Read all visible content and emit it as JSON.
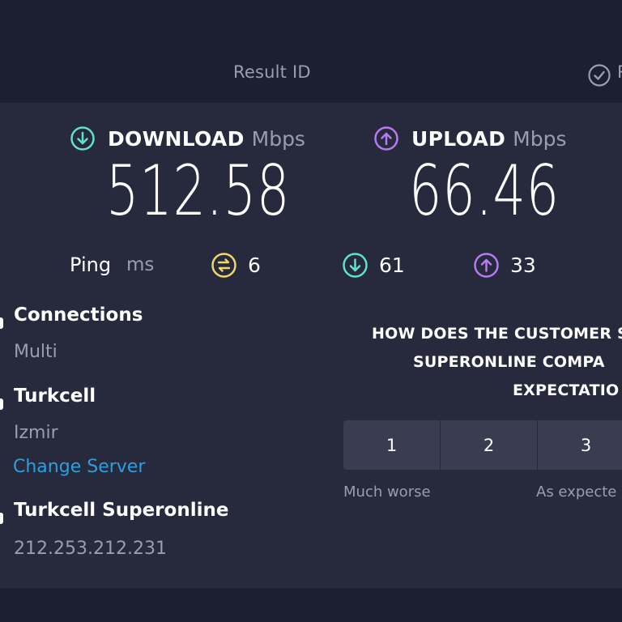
{
  "header": {
    "result_id_label": "Result ID",
    "cutoff_letter": "R"
  },
  "download": {
    "label": "DOWNLOAD",
    "unit": "Mbps",
    "value": "512.58",
    "icon": "download-arrow-icon",
    "color": "#5ee3c8"
  },
  "upload": {
    "label": "UPLOAD",
    "unit": "Mbps",
    "value": "66.46",
    "icon": "upload-arrow-icon",
    "color": "#b47cf2"
  },
  "ping": {
    "label": "Ping",
    "unit": "ms",
    "idle": "6",
    "download": "61",
    "upload": "33",
    "idle_color": "#f4d56a"
  },
  "connections": {
    "title": "Connections",
    "value": "Multi"
  },
  "server": {
    "provider": "Turkcell",
    "location": "Izmir",
    "change_link": "Change Server"
  },
  "isp": {
    "name": "Turkcell Superonline",
    "ip": "212.253.212.231"
  },
  "survey": {
    "question_lines": [
      "HOW DOES THE CUSTOMER S",
      "SUPERONLINE COMPA",
      "EXPECTATIO"
    ],
    "options": [
      "1",
      "2",
      "3"
    ],
    "low_label": "Much worse",
    "mid_label": "As expecte"
  }
}
